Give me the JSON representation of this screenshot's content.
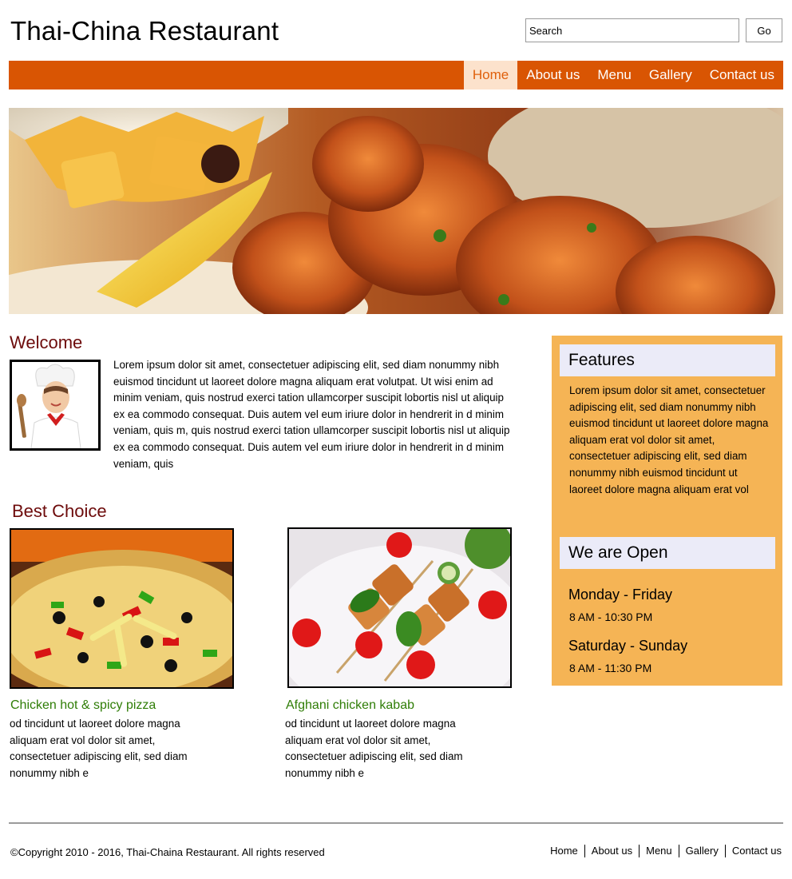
{
  "header": {
    "site_title": "Thai-China Restaurant",
    "search_placeholder": "Search",
    "go_label": "Go"
  },
  "nav": {
    "items": [
      {
        "label": "Home",
        "active": true
      },
      {
        "label": "About us",
        "active": false
      },
      {
        "label": "Menu",
        "active": false
      },
      {
        "label": "Gallery",
        "active": false
      },
      {
        "label": "Contact us",
        "active": false
      }
    ]
  },
  "welcome": {
    "heading": "Welcome",
    "text": "Lorem ipsum dolor sit amet, consectetuer adipiscing elit, sed diam nonummy nibh euismod tincidunt ut laoreet dolore magna aliquam erat volutpat. Ut wisi enim ad minim veniam, quis nostrud exerci tation ullamcorper suscipit lobortis nisl ut aliquip ex ea commodo consequat. Duis autem vel eum iriure dolor in hendrerit in d minim veniam, quis  m, quis nostrud exerci tation ullamcorper suscipit lobortis nisl ut aliquip ex ea commodo consequat. Duis autem vel eum iriure dolor in hendrerit in d minim veniam, quis"
  },
  "best_choice": {
    "heading": "Best Choice",
    "dishes": [
      {
        "title": "Chicken hot & spicy pizza",
        "desc": "od tincidunt ut laoreet dolore magna aliquam erat vol  dolor sit amet, consectetuer adipiscing elit, sed diam nonummy nibh e"
      },
      {
        "title": "Afghani chicken kabab",
        "desc": "od tincidunt ut laoreet dolore magna aliquam erat vol  dolor sit amet, consectetuer adipiscing elit, sed diam nonummy nibh e"
      }
    ]
  },
  "sidebar": {
    "features_heading": "Features",
    "features_text": "Lorem ipsum dolor sit amet, consectetuer adipiscing elit, sed diam nonummy nibh euismod tincidunt ut laoreet dolore magna aliquam erat vol dolor sit amet, consectetuer adipiscing elit, sed diam nonummy nibh euismod tincidunt ut laoreet dolore magna aliquam erat vol",
    "open_heading": "We are Open",
    "hours": [
      {
        "days": "Monday - Friday",
        "time": "8 AM - 10:30 PM"
      },
      {
        "days": "Saturday - Sunday",
        "time": "8 AM - 11:30 PM"
      }
    ]
  },
  "footer": {
    "copyright": "©Copyright 2010 - 2016, Thai-Chaina Restaurant. All rights reserved",
    "links": [
      "Home",
      "About us",
      "Menu",
      "Gallery",
      "Contact us"
    ]
  },
  "colors": {
    "nav_bg": "#d95503",
    "nav_active_bg": "#fce2cc",
    "heading": "#6d0b0b",
    "dish_title": "#2f7d06",
    "sidebar_bg": "#f5b455",
    "sidebar_heading_bg": "#ebebf8"
  }
}
